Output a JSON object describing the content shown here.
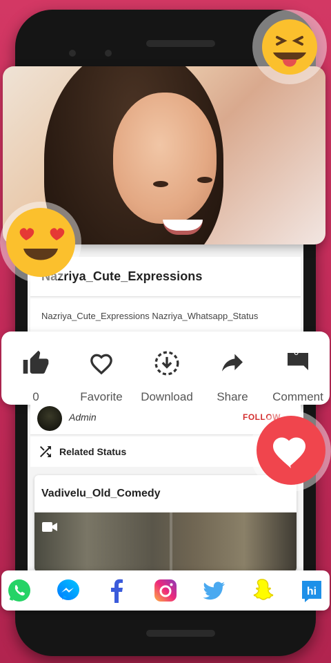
{
  "video": {
    "title": "Nazriya_Cute_Expressions",
    "tags": "Nazriya_Cute_Expressions Nazriya_Whatsapp_Status"
  },
  "actions": [
    {
      "icon": "like-icon",
      "label": "0"
    },
    {
      "icon": "heart-outline-icon",
      "label": "Favorite"
    },
    {
      "icon": "download-icon",
      "label": "Download"
    },
    {
      "icon": "share-arrow-icon",
      "label": "Share"
    },
    {
      "icon": "comment-icon",
      "label": "Comment",
      "count": "0"
    }
  ],
  "author": {
    "name": "Admin",
    "follow_label": "FOLLOW"
  },
  "related": {
    "heading": "Related Status",
    "items": [
      {
        "title": "Vadivelu_Old_Comedy"
      }
    ]
  },
  "share_apps": [
    "whatsapp",
    "messenger",
    "facebook",
    "instagram",
    "twitter",
    "snapchat",
    "hike"
  ],
  "colors": {
    "background": "#c42b5a",
    "follow": "#d32f2f",
    "heart": "#f0454d",
    "emoji": "#fbc02d"
  }
}
